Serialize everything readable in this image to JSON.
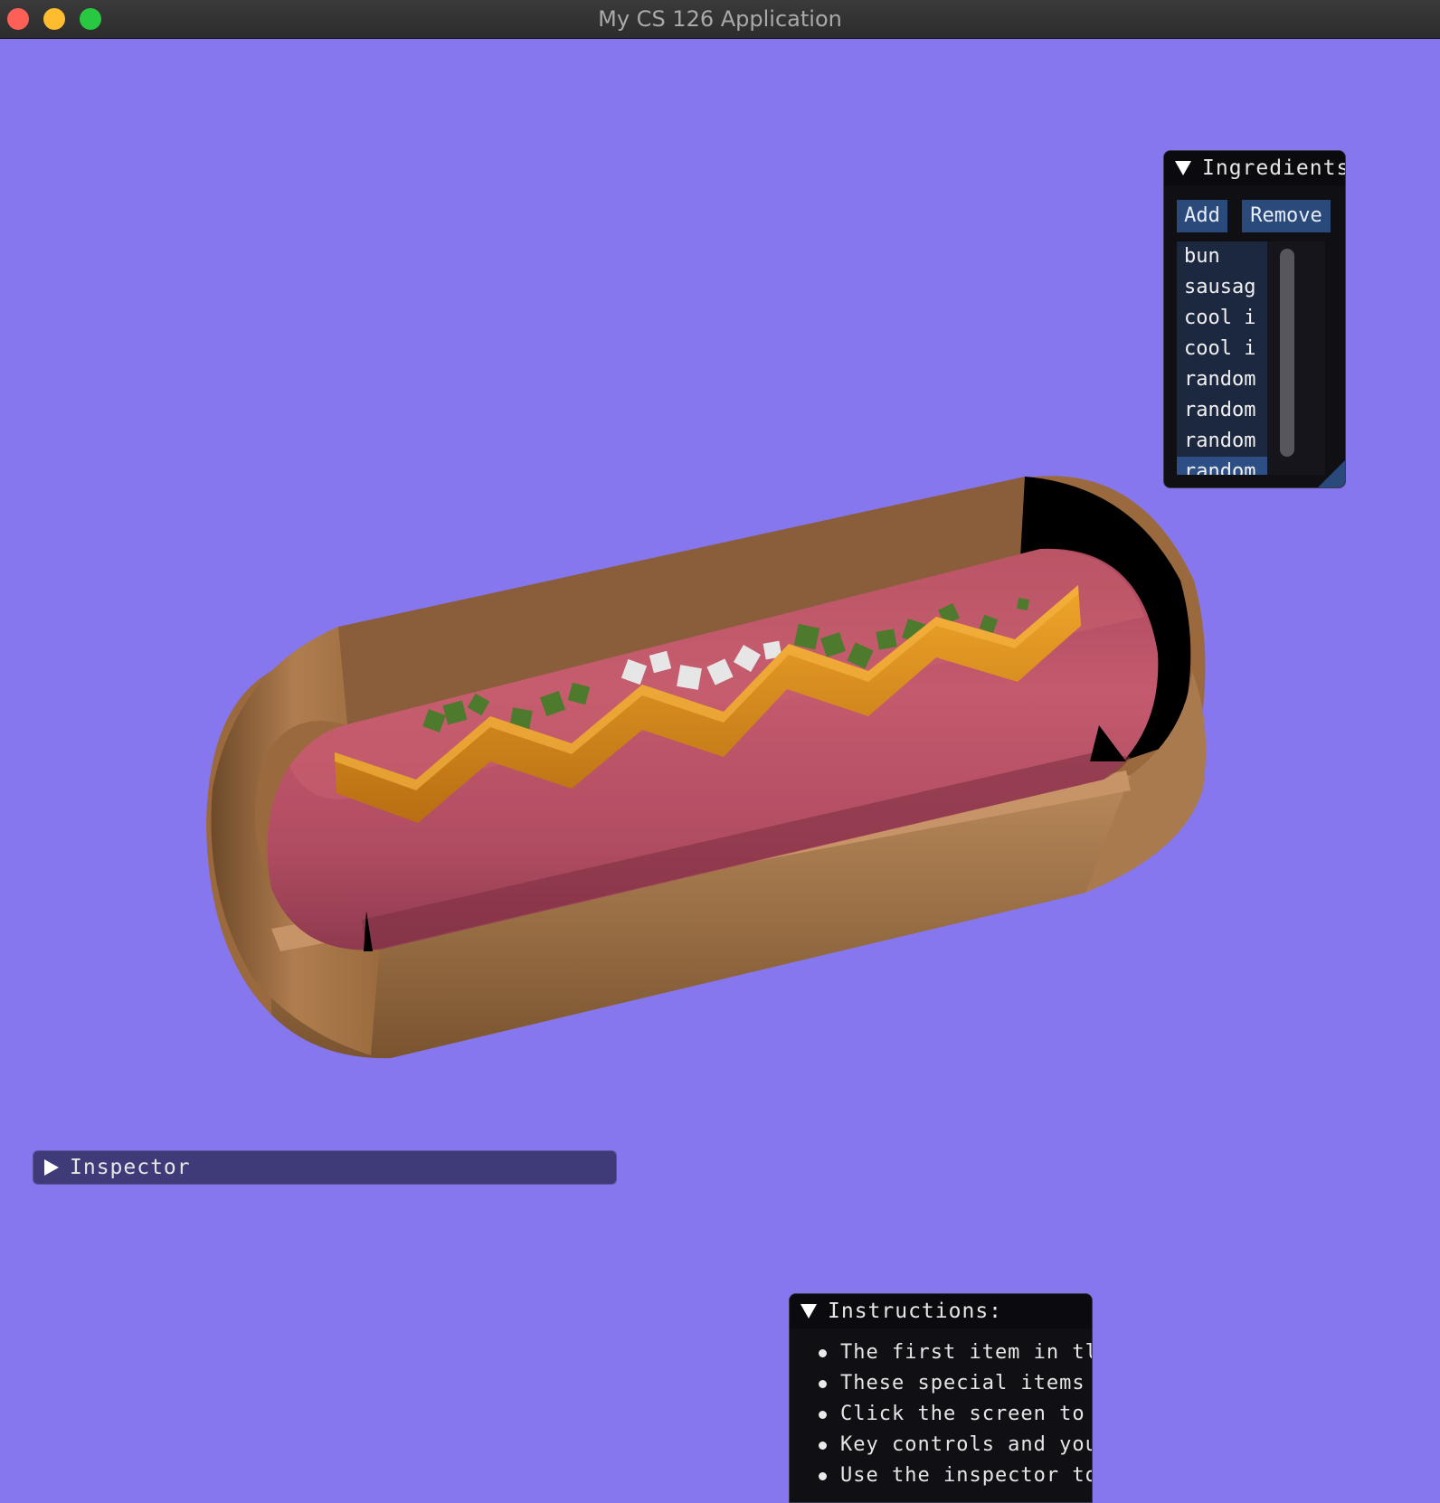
{
  "window": {
    "title": "My CS 126 Application"
  },
  "ingredients": {
    "title": "Ingredients",
    "add_label": "Add",
    "remove_label": "Remove",
    "items": [
      "bun",
      "sausag",
      "cool i",
      "cool i",
      "random",
      "random",
      "random",
      "random"
    ]
  },
  "inspector": {
    "title": "Inspector"
  },
  "instructions": {
    "title": "Instructions:",
    "items": [
      "The first item in tl",
      "These special items",
      "Click the screen to",
      "Key controls and you",
      "Use the inspector to"
    ]
  },
  "colors": {
    "background": "#8777ee",
    "bun": "#b17f52",
    "sausage": "#c05468",
    "mustard": "#e2941e",
    "relish": "#4d7a2c",
    "onion": "#e8e8e8",
    "panel": "#0f0f14",
    "button": "#2b4a7c"
  },
  "icons": [
    "collapse-arrow-icon",
    "expand-arrow-icon"
  ]
}
